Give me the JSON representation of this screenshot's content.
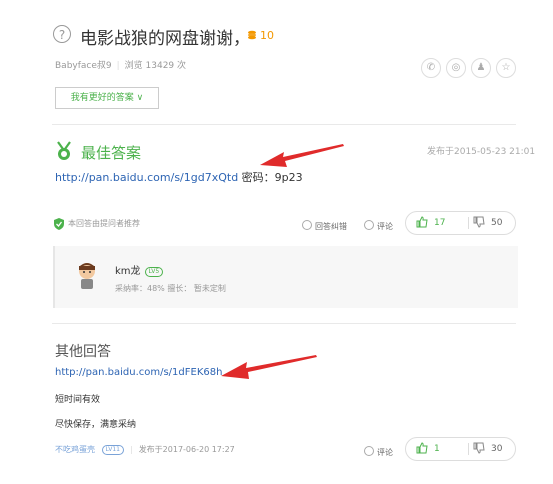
{
  "question": {
    "title": "电影战狼的网盘谢谢，",
    "reward": "10",
    "asker": "Babyface叔9",
    "views": "浏览 13429 次",
    "better_answer_button": "我有更好的答案 ∨"
  },
  "best_answer": {
    "heading": "最佳答案",
    "time": "发布于2015-05-23 21:01",
    "link": "http://pan.baidu.com/s/1gd7xQtd",
    "password_text": " 密码：9p23",
    "recommend_text": "本回答由提问者推荐",
    "correct_label": "回答纠错",
    "comment_label": "评论",
    "upvotes": "17",
    "downvotes": "50"
  },
  "answerer": {
    "name": "km龙",
    "level": "LV5",
    "stats": "采纳率：48%   擅长：  暂未定制"
  },
  "other_answers": {
    "heading": "其他回答",
    "link": "http://pan.baidu.com/s/1dFEK68h",
    "line1": "短时间有效",
    "line2": "尽快保存，满意采纳",
    "user": "不吃鸡蛋壳",
    "level": "LV11",
    "time": "发布于2017-06-20 17:27",
    "comment_label": "评论",
    "upvotes": "1",
    "downvotes": "30"
  },
  "colors": {
    "accent": "#4cb24c",
    "link": "#2d64b3",
    "arrow": "#e02b2b",
    "reward": "#f39800"
  },
  "icons": [
    "question-icon",
    "coin-icon",
    "wechat-icon",
    "weibo-icon",
    "qq-icon",
    "star-icon",
    "best-answer-medal-icon",
    "shield-icon",
    "thumb-up-icon",
    "thumb-down-icon",
    "avatar",
    "red-arrow"
  ]
}
